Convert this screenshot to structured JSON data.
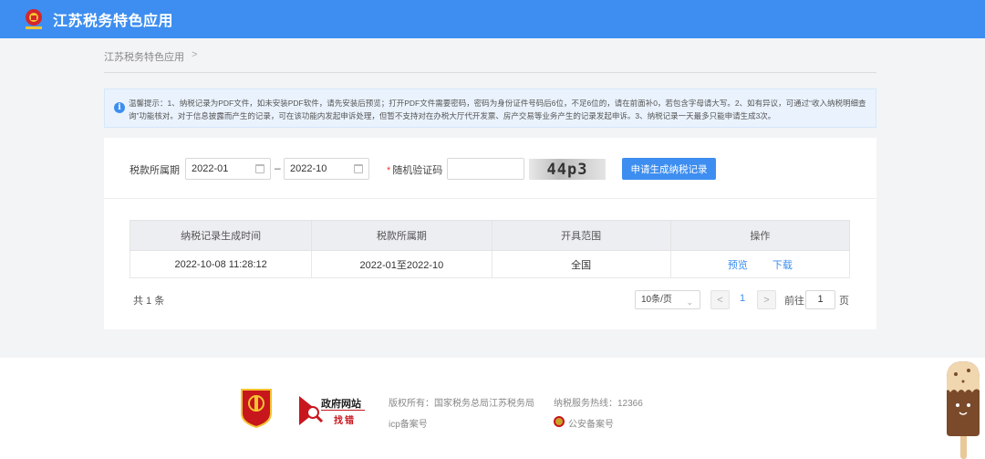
{
  "header": {
    "app_title": "江苏税务特色应用"
  },
  "breadcrumb": {
    "item": "江苏税务特色应用",
    "separator": ">"
  },
  "notice": {
    "icon": "info-icon",
    "text": "温馨提示：1、纳税记录为PDF文件，如未安装PDF软件，请先安装后预览；打开PDF文件需要密码，密码为身份证件号码后6位，不足6位的，请在前面补0，若包含字母请大写。2、如有异议，可通过“收入纳税明细查询”功能核对。对于信息披露而产生的记录，可在该功能内发起申诉处理，但暂不支持对在办税大厅代开发票、房产交易等业务产生的记录发起申诉。3、纳税记录一天最多只能申请生成3次。"
  },
  "form": {
    "period_label": "税款所属期",
    "start_date": "2022-01",
    "end_date": "2022-10",
    "range_sep": "–",
    "captcha_required_mark": "*",
    "captcha_label": "随机验证码",
    "captcha_value": "",
    "captcha_image_text": "44p3",
    "generate_button": "申请生成纳税记录"
  },
  "table": {
    "headers": [
      "纳税记录生成时间",
      "税款所属期",
      "开具范围",
      "操作"
    ],
    "rows": [
      {
        "generated_time": "2022-10-08 11:28:12",
        "period": "2022-01至2022-10",
        "scope": "全国",
        "preview": "预览",
        "download": "下载"
      }
    ]
  },
  "pagination": {
    "total": "共 1 条",
    "page_size": "10条/页",
    "prev": "<",
    "current_page": "1",
    "next": ">",
    "goto_label": "前往",
    "goto_value": "1",
    "page_unit": "页"
  },
  "footer": {
    "emblem_text": "党政机关",
    "gov_site_title": "政府网站",
    "gov_site_sub": "找错",
    "copyright": "版权所有：国家税务总局江苏税务局",
    "hotline": "纳税服务热线：12366",
    "icp": "icp备案号",
    "police": "公安备案号"
  },
  "colors": {
    "primary": "#3d8ef0",
    "header_bg": "#3d8ef0",
    "red": "#c8161d",
    "page_bg": "#f3f4f6"
  }
}
